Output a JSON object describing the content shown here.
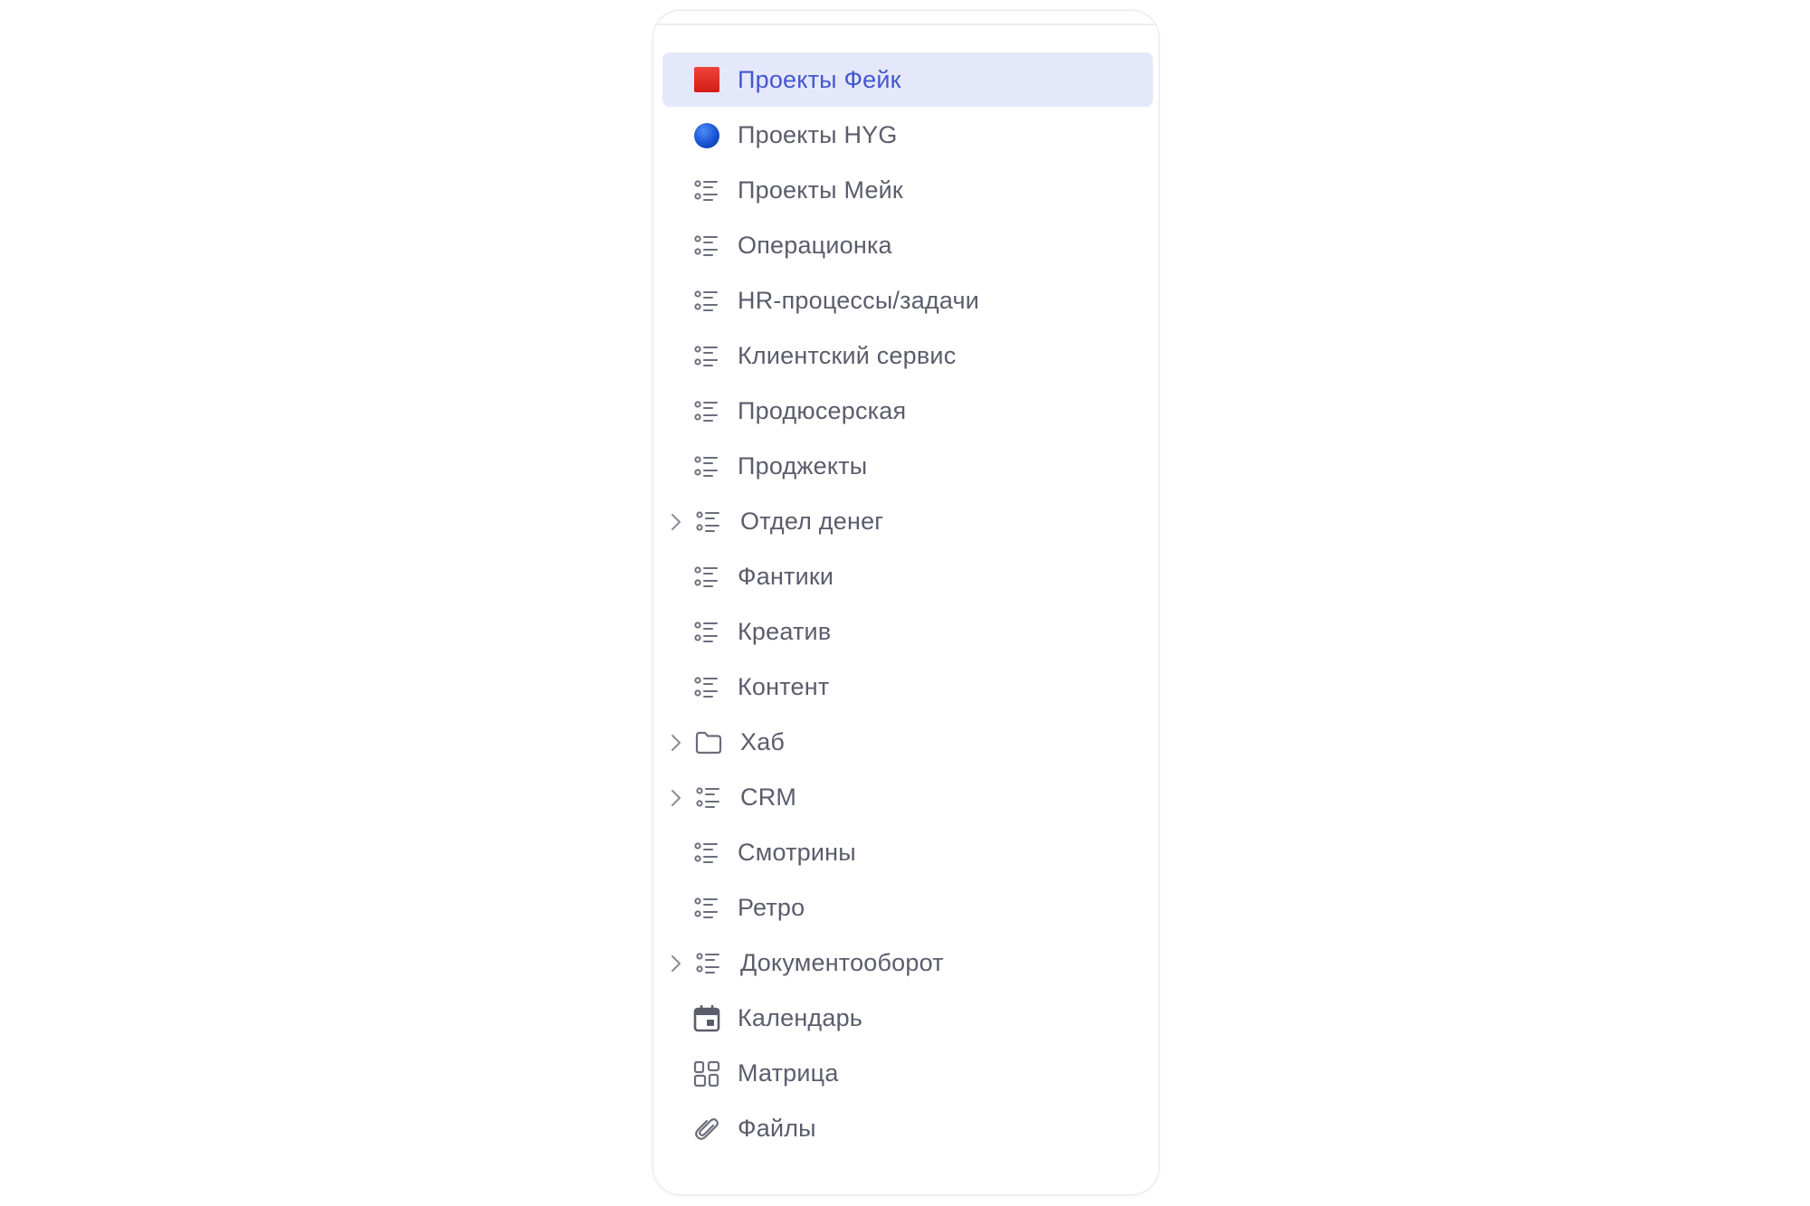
{
  "sidebar": {
    "items": [
      {
        "label": "Проекты Фейк",
        "icon": "red-square-icon",
        "selected": true,
        "expandable": false
      },
      {
        "label": "Проекты HYG",
        "icon": "blue-circle-icon",
        "selected": false,
        "expandable": false
      },
      {
        "label": "Проекты Мейк",
        "icon": "list-icon",
        "selected": false,
        "expandable": false
      },
      {
        "label": "Операционка",
        "icon": "list-icon",
        "selected": false,
        "expandable": false
      },
      {
        "label": "HR-процессы/задачи",
        "icon": "list-icon",
        "selected": false,
        "expandable": false
      },
      {
        "label": "Клиентский сервис",
        "icon": "list-icon",
        "selected": false,
        "expandable": false
      },
      {
        "label": "Продюсерская",
        "icon": "list-icon",
        "selected": false,
        "expandable": false
      },
      {
        "label": "Проджекты",
        "icon": "list-icon",
        "selected": false,
        "expandable": false
      },
      {
        "label": "Отдел денег",
        "icon": "list-icon",
        "selected": false,
        "expandable": true
      },
      {
        "label": "Фантики",
        "icon": "list-icon",
        "selected": false,
        "expandable": false
      },
      {
        "label": "Креатив",
        "icon": "list-icon",
        "selected": false,
        "expandable": false
      },
      {
        "label": "Контент",
        "icon": "list-icon",
        "selected": false,
        "expandable": false
      },
      {
        "label": "Хаб",
        "icon": "folder-icon",
        "selected": false,
        "expandable": true
      },
      {
        "label": "CRM",
        "icon": "list-icon",
        "selected": false,
        "expandable": true
      },
      {
        "label": "Смотрины",
        "icon": "list-icon",
        "selected": false,
        "expandable": false
      },
      {
        "label": "Ретро",
        "icon": "list-icon",
        "selected": false,
        "expandable": false
      },
      {
        "label": "Документооборот",
        "icon": "list-icon",
        "selected": false,
        "expandable": true
      },
      {
        "label": "Календарь",
        "icon": "calendar-icon",
        "selected": false,
        "expandable": false
      },
      {
        "label": "Матрица",
        "icon": "matrix-icon",
        "selected": false,
        "expandable": false
      },
      {
        "label": "Файлы",
        "icon": "paperclip-icon",
        "selected": false,
        "expandable": false
      }
    ]
  },
  "colors": {
    "selected_bg": "#e4e8fa",
    "selected_text": "#4457d0",
    "text": "#5a5d6b",
    "icon": "#6b6e7c",
    "red_square": "#e0291f",
    "blue_circle": "#1a55d6"
  }
}
